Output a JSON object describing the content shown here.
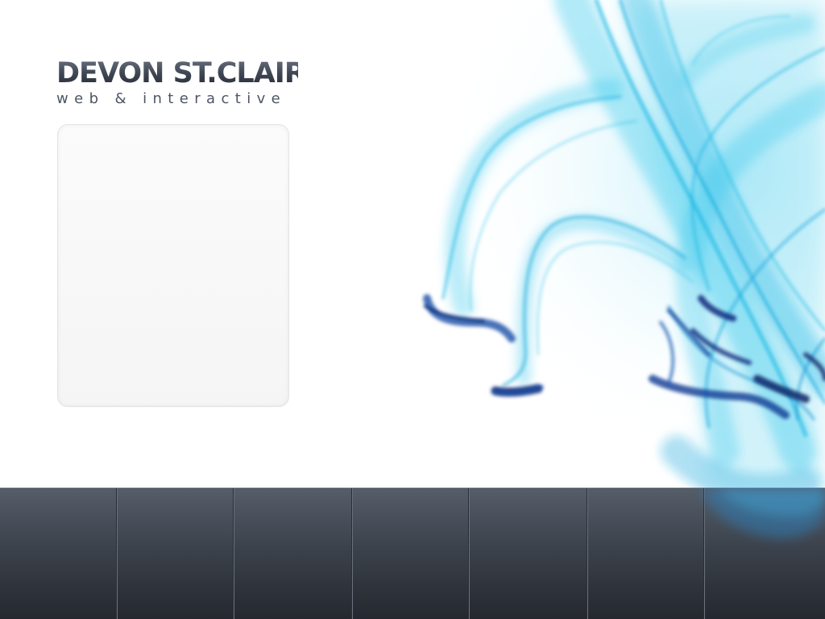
{
  "brand": {
    "name": "DEVON ST.CLAIR",
    "tagline": "web & interactive",
    "logo_color": "#3d4452"
  },
  "background": {
    "image_name": "blue-smoke-artwork",
    "accent_colors": [
      "#1ec4e6",
      "#0a8fd1",
      "#0b2a7a"
    ]
  },
  "content_panel": {
    "text": ""
  },
  "nav": {
    "bar_color": "#3c424c",
    "tabs": [
      {
        "label": ""
      },
      {
        "label": ""
      },
      {
        "label": ""
      },
      {
        "label": ""
      },
      {
        "label": ""
      },
      {
        "label": ""
      },
      {
        "label": ""
      }
    ]
  }
}
